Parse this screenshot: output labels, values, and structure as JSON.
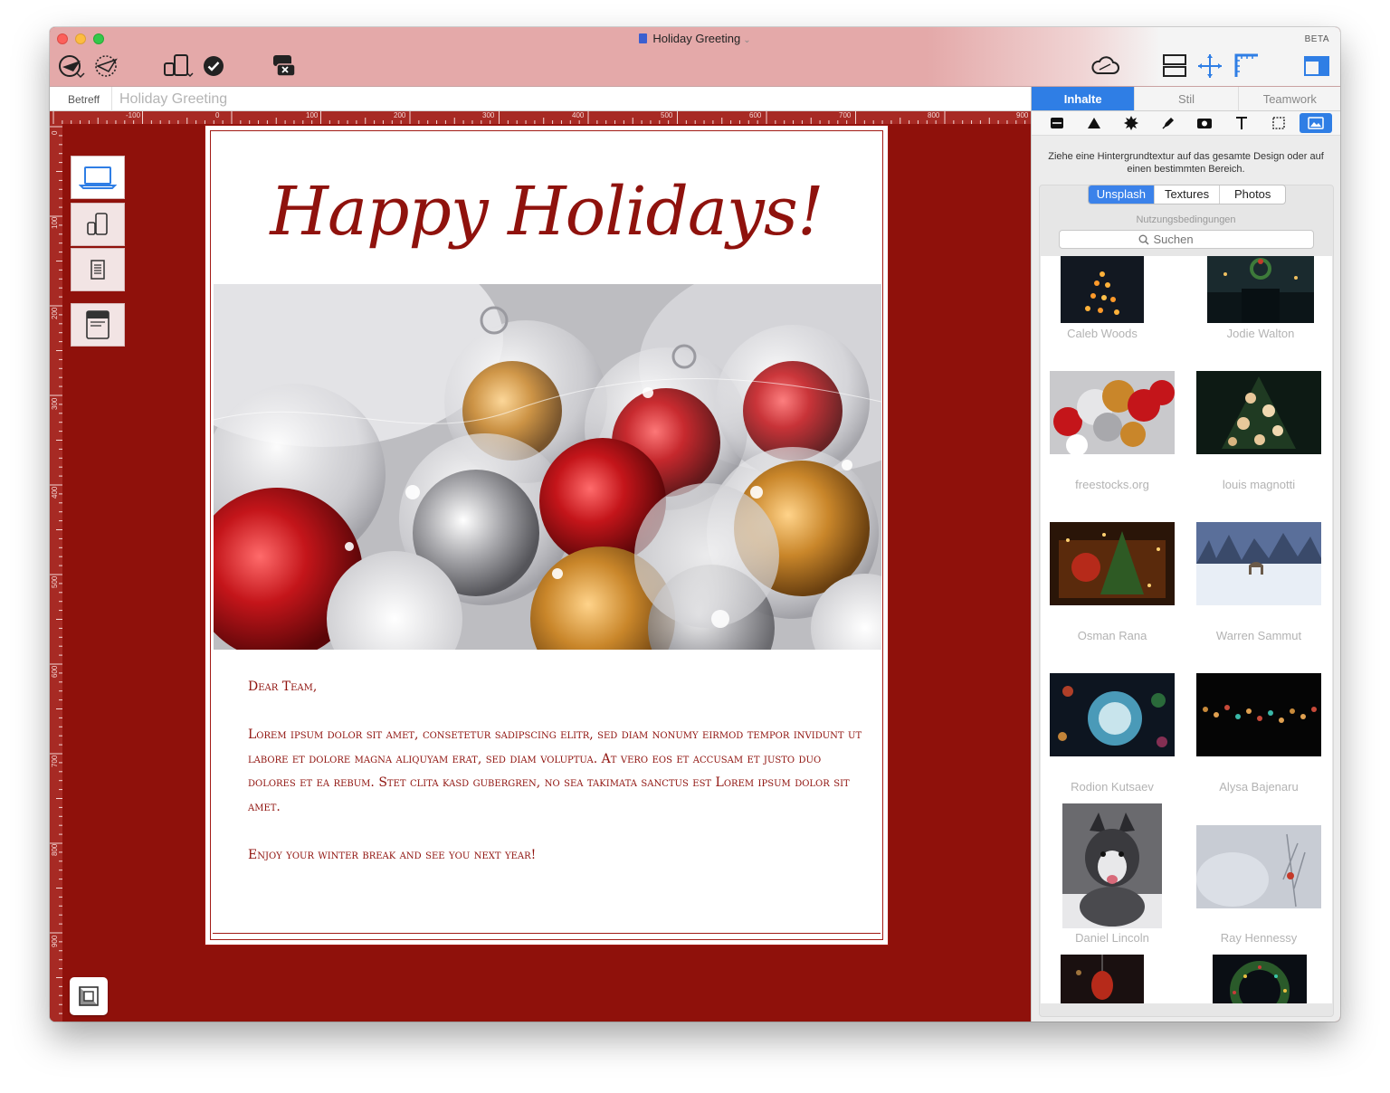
{
  "window": {
    "title": "Holiday Greeting",
    "badge": "BETA"
  },
  "subject": {
    "label": "Betreff",
    "value": "Holiday Greeting"
  },
  "ruler": {
    "horizontal": [
      "-100",
      "0",
      "100",
      "200",
      "300",
      "400",
      "500",
      "600",
      "700",
      "800",
      "900"
    ],
    "vertical": [
      "0",
      "100",
      "200",
      "300",
      "400",
      "500",
      "600",
      "700",
      "800",
      "900"
    ]
  },
  "email": {
    "headline": "Happy Holidays!",
    "greeting": "Dear Team,",
    "body": "Lorem ipsum dolor sit amet, consetetur sadipscing elitr, sed diam nonumy eirmod tempor invidunt ut labore et dolore magna aliquyam erat, sed diam voluptua. At vero eos et accusam et justo duo dolores et ea rebum. Stet clita kasd gubergren, no sea takimata sanctus est Lorem ipsum dolor sit amet.",
    "closing": "Enjoy your winter break and see you next year!"
  },
  "panel": {
    "tabs": [
      "Inhalte",
      "Stil",
      "Teamwork"
    ],
    "hint": "Ziehe eine Hintergrundtextur auf das gesamte Design oder auf einen bestimmten Bereich.",
    "sources": [
      "Unsplash",
      "Textures",
      "Photos"
    ],
    "terms": "Nutzungsbedingungen",
    "search_placeholder": "Suchen",
    "photos": [
      "Caleb Woods",
      "Jodie Walton",
      "freestocks.org",
      "louis magnotti",
      "Osman Rana",
      "Warren Sammut",
      "Rodion Kutsaev",
      "Alysa Bajenaru",
      "Daniel Lincoln",
      "Ray Hennessy"
    ]
  },
  "colors": {
    "accent": "#2f7ee5",
    "canvas": "#8f110b",
    "brand_red": "#8f120d"
  }
}
